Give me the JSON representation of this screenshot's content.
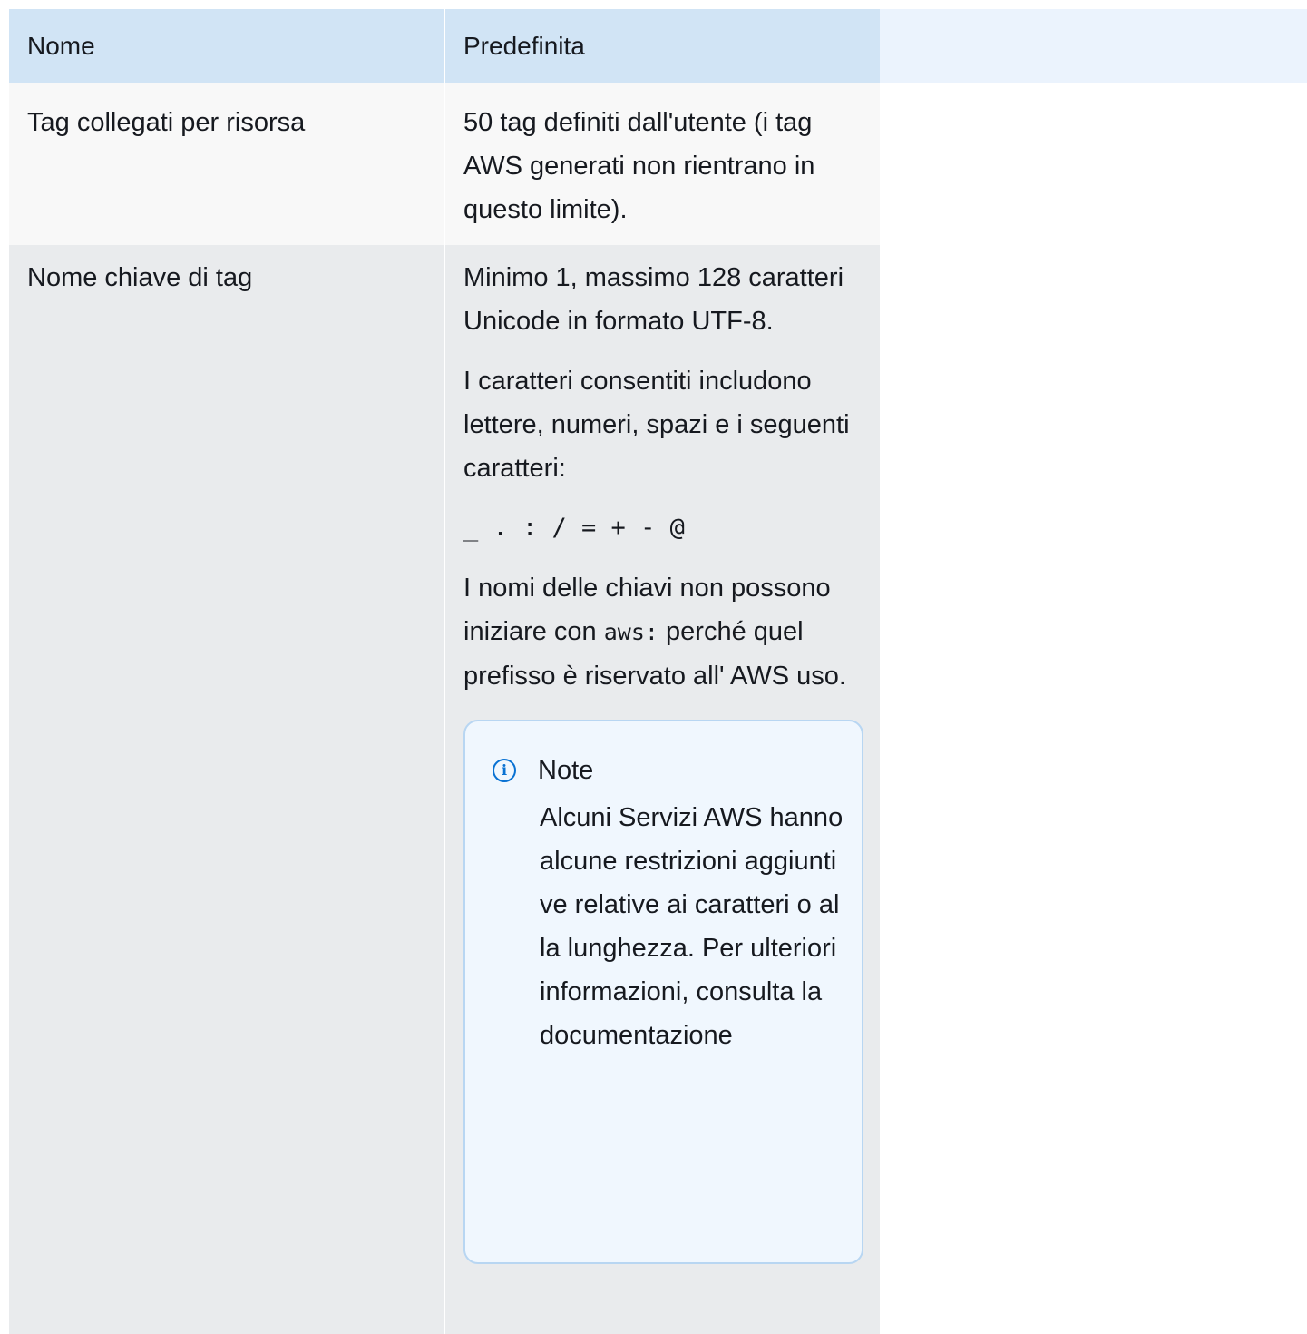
{
  "table": {
    "headers": [
      "Nome",
      "Predefinita"
    ],
    "rows": [
      {
        "name": "Tag collegati per risorsa",
        "default_text": "50 tag definiti dall'utente (i tag AWS generati non rientrano in questo limite)."
      },
      {
        "name": "Nome chiave di tag",
        "para1": "Minimo 1, massimo 128 caratteri Unicode in formato UTF-8.",
        "para2": "I caratteri consentiti includono lettere, numeri, spazi e i seguenti caratteri:",
        "symbols": "_ . : / = + - @",
        "para3_pre": "I nomi delle chiavi non possono iniziare con ",
        "para3_code": "aws:",
        "para3_post": " perché quel prefisso è riservato all' AWS uso.",
        "note": {
          "icon": "info-icon",
          "title": "Note",
          "body": "Alcuni Servizi AWS hanno alcune restrizioni aggiuntive relative ai caratteri o alla lunghezza. Per ulteriori informazioni, consulta la documentazione"
        }
      }
    ]
  }
}
